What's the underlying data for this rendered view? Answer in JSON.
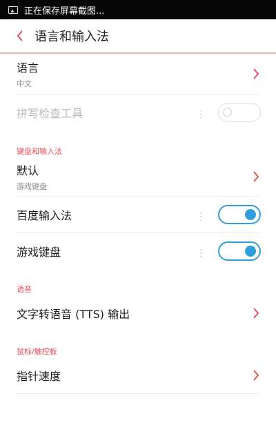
{
  "status_bar": {
    "notification_icon": "image-icon",
    "text": "正在保存屏幕截图..."
  },
  "app_bar": {
    "back_icon": "chevron-left-icon",
    "title": "语言和输入法"
  },
  "items": {
    "language": {
      "label": "语言",
      "value": "中文"
    },
    "spellcheck": {
      "label": "拼写检查工具",
      "enabled": false,
      "on": false
    }
  },
  "sections": {
    "keyboard": {
      "header": "键盘和输入法",
      "default": {
        "label": "默认",
        "value": "游戏键盘"
      },
      "baidu": {
        "label": "百度输入法",
        "on": true
      },
      "game_keyboard": {
        "label": "游戏键盘",
        "on": true
      }
    },
    "speech": {
      "header": "语音",
      "tts": {
        "label": "文字转语音 (TTS) 输出"
      }
    },
    "pointer": {
      "header": "鼠标/触控板",
      "speed": {
        "label": "指针速度"
      }
    }
  },
  "colors": {
    "accent_red": "#e8505b",
    "toggle_blue": "#2f9fdc",
    "status_bar_bg": "#050505"
  }
}
